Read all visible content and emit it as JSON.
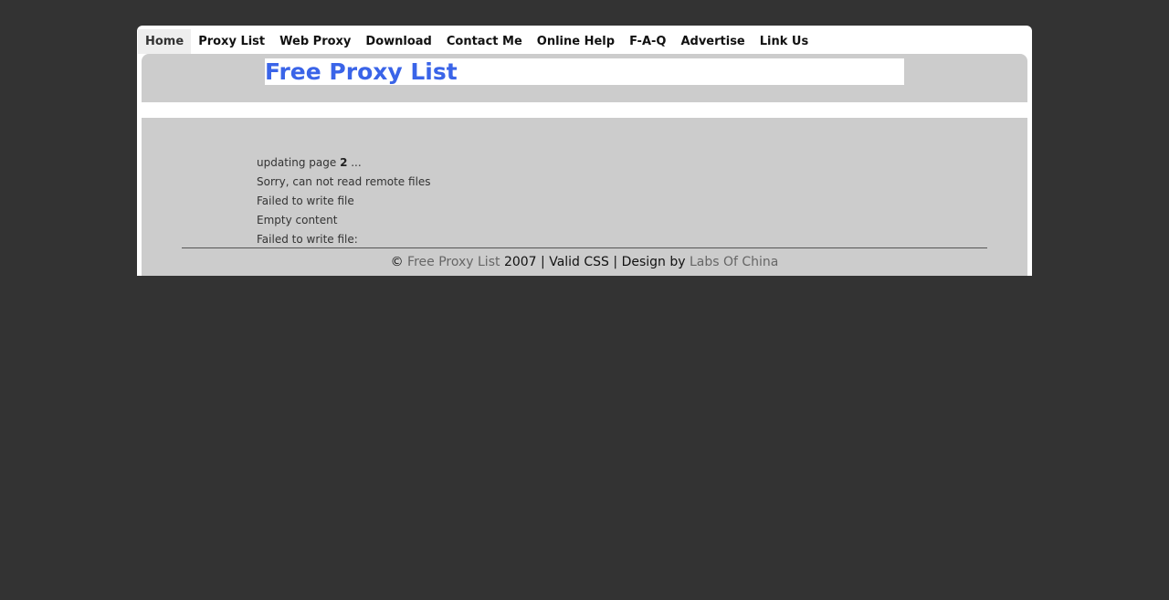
{
  "nav": {
    "items": [
      {
        "label": "Home"
      },
      {
        "label": "Proxy List"
      },
      {
        "label": "Web Proxy"
      },
      {
        "label": "Download"
      },
      {
        "label": "Contact Me"
      },
      {
        "label": "Online Help"
      },
      {
        "label": "F-A-Q"
      },
      {
        "label": "Advertise"
      },
      {
        "label": "Link Us"
      }
    ],
    "active": "Home"
  },
  "header": {
    "title": "Free Proxy List"
  },
  "messages": {
    "updating_prefix": "updating page ",
    "updating_page": "2",
    "updating_suffix": " ...",
    "lines": [
      "Sorry, can not read remote files",
      "Failed to write file",
      "Empty content",
      "Failed to write file:"
    ]
  },
  "footer": {
    "copyright": "©",
    "site_link": "Free Proxy List",
    "year": "2007",
    "sep1": "|",
    "valid_css": "Valid CSS",
    "sep2": "|",
    "design_by": "Design by",
    "designer_link": "Labs Of China"
  },
  "colors": {
    "background": "#333333",
    "panel": "#cccccc",
    "title": "#3a64e8",
    "link": "#666666"
  }
}
